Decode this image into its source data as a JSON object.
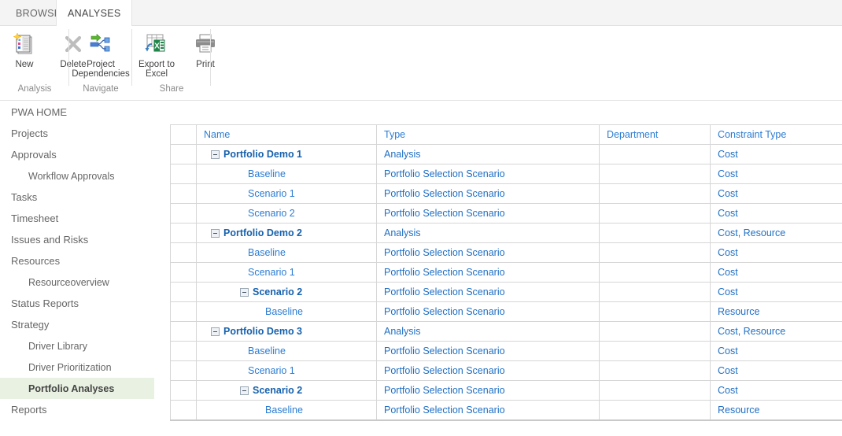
{
  "ribbon": {
    "tabs": [
      {
        "label": "BROWSE",
        "active": false
      },
      {
        "label": "ANALYSES",
        "active": true
      }
    ],
    "groups": [
      {
        "label": "Analysis",
        "buttons": [
          {
            "label": "New",
            "icon": "new-analysis-icon"
          },
          {
            "label": "Delete",
            "icon": "delete-x-icon"
          }
        ]
      },
      {
        "label": "Navigate",
        "buttons": [
          {
            "label": "Project Dependencies",
            "icon": "project-dependencies-icon"
          }
        ]
      },
      {
        "label": "Share",
        "buttons": [
          {
            "label": "Export to Excel",
            "icon": "export-to-excel-icon"
          },
          {
            "label": "Print",
            "icon": "print-icon"
          }
        ]
      }
    ]
  },
  "sidebar": {
    "items": [
      {
        "label": "PWA HOME",
        "level": 0,
        "selected": false
      },
      {
        "label": "Projects",
        "level": 0,
        "selected": false
      },
      {
        "label": "Approvals",
        "level": 0,
        "selected": false
      },
      {
        "label": "Workflow Approvals",
        "level": 1,
        "selected": false
      },
      {
        "label": "Tasks",
        "level": 0,
        "selected": false
      },
      {
        "label": "Timesheet",
        "level": 0,
        "selected": false
      },
      {
        "label": "Issues and Risks",
        "level": 0,
        "selected": false
      },
      {
        "label": "Resources",
        "level": 0,
        "selected": false
      },
      {
        "label": "Resourceoverview",
        "level": 1,
        "selected": false
      },
      {
        "label": "Status Reports",
        "level": 0,
        "selected": false
      },
      {
        "label": "Strategy",
        "level": 0,
        "selected": false
      },
      {
        "label": "Driver Library",
        "level": 1,
        "selected": false
      },
      {
        "label": "Driver Prioritization",
        "level": 1,
        "selected": false
      },
      {
        "label": "Portfolio Analyses",
        "level": 1,
        "selected": true
      },
      {
        "label": "Reports",
        "level": 0,
        "selected": false
      }
    ]
  },
  "grid": {
    "columns": [
      "",
      "Name",
      "Type",
      "Department",
      "Constraint Type"
    ],
    "rows": [
      {
        "name": "Portfolio Demo 1",
        "level": 0,
        "expanded": true,
        "type": "Analysis",
        "department": "",
        "constraint": "Cost"
      },
      {
        "name": "Baseline",
        "level": 1,
        "expanded": false,
        "type": "Portfolio Selection Scenario",
        "department": "",
        "constraint": "Cost"
      },
      {
        "name": "Scenario 1",
        "level": 1,
        "expanded": false,
        "type": "Portfolio Selection Scenario",
        "department": "",
        "constraint": "Cost"
      },
      {
        "name": "Scenario 2",
        "level": 1,
        "expanded": false,
        "type": "Portfolio Selection Scenario",
        "department": "",
        "constraint": "Cost"
      },
      {
        "name": "Portfolio Demo 2",
        "level": 0,
        "expanded": true,
        "type": "Analysis",
        "department": "",
        "constraint": "Cost, Resource"
      },
      {
        "name": "Baseline",
        "level": 1,
        "expanded": false,
        "type": "Portfolio Selection Scenario",
        "department": "",
        "constraint": "Cost"
      },
      {
        "name": "Scenario 1",
        "level": 1,
        "expanded": false,
        "type": "Portfolio Selection Scenario",
        "department": "",
        "constraint": "Cost"
      },
      {
        "name": "Scenario 2",
        "level": 2,
        "expanded": true,
        "type": "Portfolio Selection Scenario",
        "department": "",
        "constraint": "Cost"
      },
      {
        "name": "Baseline",
        "level": 3,
        "expanded": false,
        "type": "Portfolio Selection Scenario",
        "department": "",
        "constraint": "Resource"
      },
      {
        "name": "Portfolio Demo 3",
        "level": 0,
        "expanded": true,
        "type": "Analysis",
        "department": "",
        "constraint": "Cost, Resource"
      },
      {
        "name": "Baseline",
        "level": 1,
        "expanded": false,
        "type": "Portfolio Selection Scenario",
        "department": "",
        "constraint": "Cost"
      },
      {
        "name": "Scenario 1",
        "level": 1,
        "expanded": false,
        "type": "Portfolio Selection Scenario",
        "department": "",
        "constraint": "Cost"
      },
      {
        "name": "Scenario 2",
        "level": 2,
        "expanded": true,
        "type": "Portfolio Selection Scenario",
        "department": "",
        "constraint": "Cost"
      },
      {
        "name": "Baseline",
        "level": 3,
        "expanded": false,
        "type": "Portfolio Selection Scenario",
        "department": "",
        "constraint": "Resource"
      }
    ]
  },
  "colors": {
    "link": "#2b7cd3",
    "link_bold": "#1661ad",
    "selected_nav_bg": "#e9f2e2",
    "grid_border": "#d6d6d6",
    "ribbon_tabbar_bg": "#f4f4f4"
  }
}
